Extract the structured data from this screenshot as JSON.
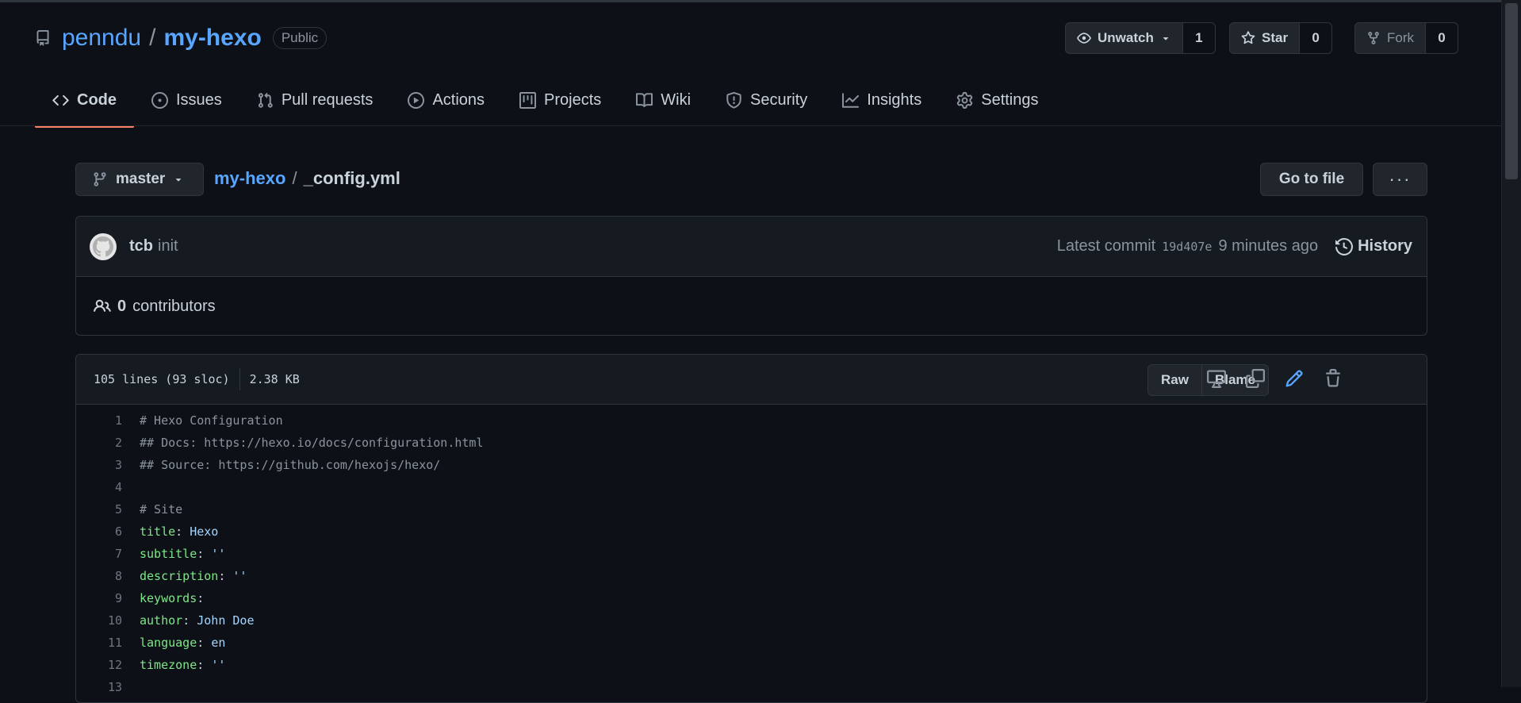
{
  "repo": {
    "owner": "penndu",
    "separator": "/",
    "name": "my-hexo",
    "visibility": "Public"
  },
  "actions": {
    "watch": {
      "label": "Unwatch",
      "count": "1"
    },
    "star": {
      "label": "Star",
      "count": "0"
    },
    "fork": {
      "label": "Fork",
      "count": "0"
    }
  },
  "tabs": [
    {
      "label": "Code",
      "icon": "code-icon",
      "active": true
    },
    {
      "label": "Issues",
      "icon": "issue-icon"
    },
    {
      "label": "Pull requests",
      "icon": "pull-request-icon"
    },
    {
      "label": "Actions",
      "icon": "play-icon"
    },
    {
      "label": "Projects",
      "icon": "project-icon"
    },
    {
      "label": "Wiki",
      "icon": "book-icon"
    },
    {
      "label": "Security",
      "icon": "shield-icon"
    },
    {
      "label": "Insights",
      "icon": "graph-icon"
    },
    {
      "label": "Settings",
      "icon": "gear-icon"
    }
  ],
  "branch": {
    "name": "master"
  },
  "breadcrumb": {
    "repo": "my-hexo",
    "separator": "/",
    "file": "_config.yml"
  },
  "file_actions": {
    "goto": "Go to file",
    "more": "···"
  },
  "commit": {
    "author": "tcb",
    "message": "init",
    "latest_label": "Latest commit",
    "sha": "19d407e",
    "time": "9 minutes ago",
    "history": "History"
  },
  "contributors": {
    "count": "0",
    "label": "contributors"
  },
  "file": {
    "lines_info": "105 lines (93 sloc)",
    "size": "2.38 KB",
    "raw": "Raw",
    "blame": "Blame"
  },
  "code_lines": [
    {
      "n": "1",
      "comment": "# Hexo Configuration"
    },
    {
      "n": "2",
      "comment": "## Docs: https://hexo.io/docs/configuration.html"
    },
    {
      "n": "3",
      "comment": "## Source: https://github.com/hexojs/hexo/"
    },
    {
      "n": "4"
    },
    {
      "n": "5",
      "comment": "# Site"
    },
    {
      "n": "6",
      "key": "title",
      "value": "Hexo"
    },
    {
      "n": "7",
      "key": "subtitle",
      "value": "''"
    },
    {
      "n": "8",
      "key": "description",
      "value": "''"
    },
    {
      "n": "9",
      "key": "keywords",
      "value": ""
    },
    {
      "n": "10",
      "key": "author",
      "value": "John Doe"
    },
    {
      "n": "11",
      "key": "language",
      "value": "en"
    },
    {
      "n": "12",
      "key": "timezone",
      "value": "''"
    },
    {
      "n": "13"
    }
  ],
  "colors": {
    "background": "#0d1117",
    "accent": "#58a6ff",
    "tab_underline": "#f78166",
    "yaml_key": "#7ee787"
  }
}
